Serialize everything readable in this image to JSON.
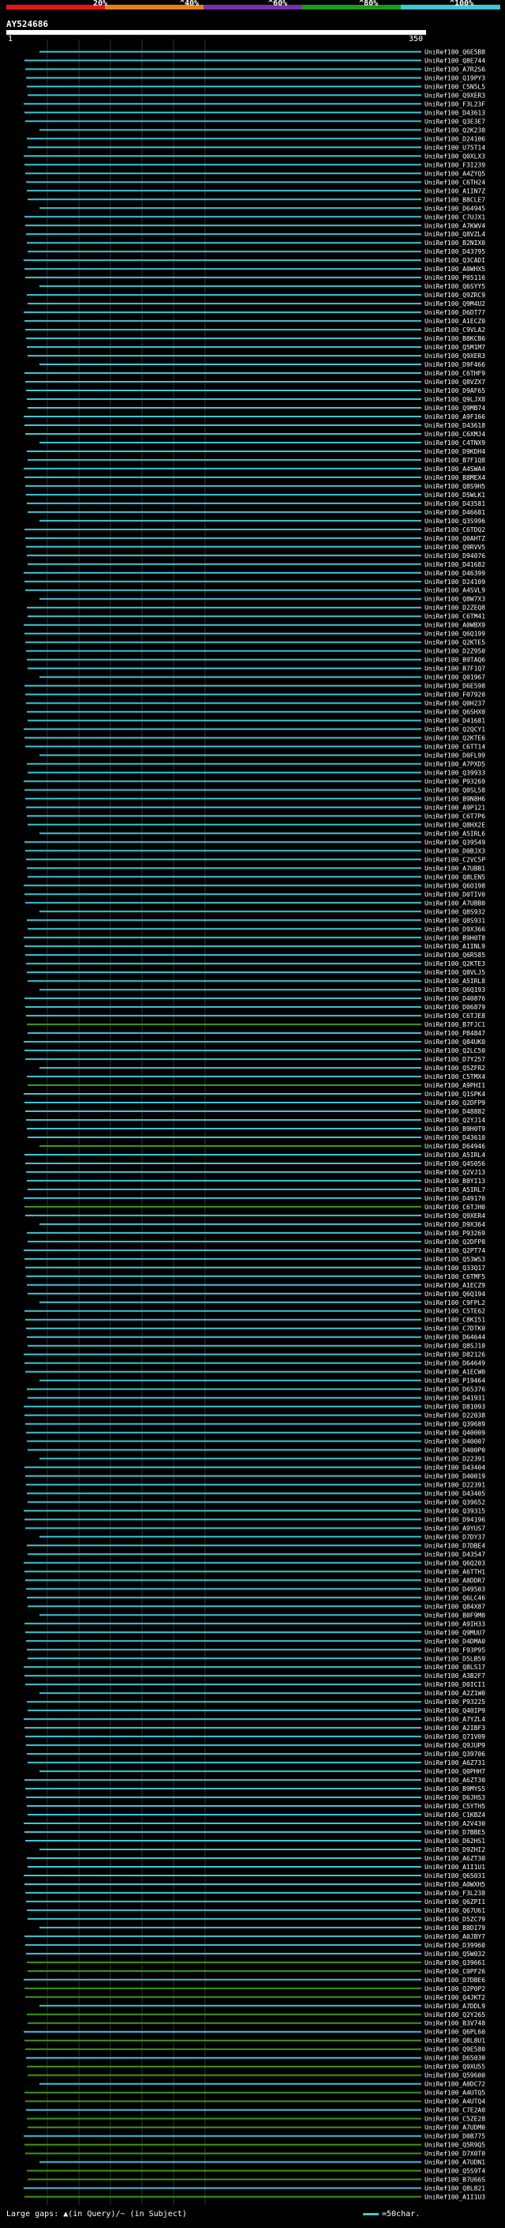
{
  "legend": {
    "labels": [
      "20%",
      "^40%",
      "^60%",
      "^80%",
      "^100%"
    ],
    "colors": [
      "#e8141c",
      "#e88014",
      "#7a2fb0",
      "#1a9a1a",
      "#3fc6d8"
    ]
  },
  "query_id": "AY524686",
  "ruler": {
    "start": "1",
    "end": "350"
  },
  "hit_color_high": "#3fc6d8",
  "hit_color_mid": "#3d9a12",
  "hits": [
    "UniRef100_Q6E5B8",
    "UniRef100_Q8E744",
    "UniRef100_A7R2S6",
    "UniRef100_Q19PY3",
    "UniRef100_C5N5L5",
    "UniRef100_Q9XER3",
    "UniRef100_F3L23F",
    "UniRef100_D43613",
    "UniRef100_Q3E3E7",
    "UniRef100_Q2K238",
    "UniRef100_D24106",
    "UniRef100_U75T14",
    "UniRef100_Q0XLX3",
    "UniRef100_F3I239",
    "UniRef100_A4ZYQ5",
    "UniRef100_C6TH24",
    "UniRef100_A1IN7Z",
    "UniRef100_B8CLE7",
    "UniRef100_D64945",
    "UniRef100_C7UJX1",
    "UniRef100_A7KWV4",
    "UniRef100_Q8VZL4",
    "UniRef100_B2NIX0",
    "UniRef100_D43795",
    "UniRef100_Q3CADI",
    "UniRef100_A0WHX5",
    "UniRef100_P05116",
    "UniRef100_Q6SYY5",
    "UniRef100_Q9ZRC9",
    "UniRef100_Q9M4U2",
    "UniRef100_D6DT77",
    "UniRef100_A1ECZ0",
    "UniRef100_C9VLA2",
    "UniRef100_B8KCB6",
    "UniRef100_Q5M1M7",
    "UniRef100_Q9XER3",
    "UniRef100_D9F466",
    "UniRef100_C6THF9",
    "UniRef100_Q8VZX7",
    "UniRef100_D9AF65",
    "UniRef100_Q9LJX8",
    "UniRef100_Q9MB74",
    "UniRef100_A9F166",
    "UniRef100_D43618",
    "UniRef100_C6XMJ4",
    "UniRef100_C4TNX9",
    "UniRef100_D9KDH4",
    "UniRef100_B7F1Q8",
    "UniRef100_A4SWA4",
    "UniRef100_B8MEX4",
    "UniRef100_Q8S9H5",
    "UniRef100_D5WLK1",
    "UniRef100_D43581",
    "UniRef100_D46681",
    "UniRef100_Q3S996",
    "UniRef100_C6TDQ2",
    "UniRef100_Q0AHTZ",
    "UniRef100_Q9RVV5",
    "UniRef100_D94076",
    "UniRef100_D41682",
    "UniRef100_D46399",
    "UniRef100_D24109",
    "UniRef100_A4SVL9",
    "UniRef100_Q8W7X3",
    "UniRef100_D2ZEQ8",
    "UniRef100_C6TM41",
    "UniRef100_A0WBX9",
    "UniRef100_Q6Q199",
    "UniRef100_Q2KTE5",
    "UniRef100_D2Z950",
    "UniRef100_B9TAQ6",
    "UniRef100_B7F1Q7",
    "UniRef100_Q01967",
    "UniRef100_D6E598",
    "UniRef100_F07920",
    "UniRef100_Q0H237",
    "UniRef100_Q6SHX0",
    "UniRef100_D41681",
    "UniRef100_Q2QCY1",
    "UniRef100_Q2KTE6",
    "UniRef100_C6TT14",
    "UniRef100_D0FL99",
    "UniRef100_A7PXD5",
    "UniRef100_Q39933",
    "UniRef100_P93269",
    "UniRef100_Q0SL58",
    "UniRef100_B9N8H6",
    "UniRef100_A9P121",
    "UniRef100_C6T7P6",
    "UniRef100_Q8HX2E",
    "UniRef100_A5IRL6",
    "UniRef100_Q39549",
    "UniRef100_D0BJX3",
    "UniRef100_C2VC5P",
    "UniRef100_A7UBB1",
    "UniRef100_Q8LEN5",
    "UniRef100_Q6O198",
    "UniRef100_D0TIV0",
    "UniRef100_A7UBB0",
    "UniRef100_Q8S932",
    "UniRef100_Q8S931",
    "UniRef100_D9X366",
    "UniRef100_B9H0T8",
    "UniRef100_A1INL9",
    "UniRef100_Q6R585",
    "UniRef100_Q2KTE3",
    "UniRef100_Q8VLJ5",
    "UniRef100_A5IRL8",
    "UniRef100_Q6Q193",
    "UniRef100_D40876",
    "UniRef100_D06879",
    "UniRef100_C6TJE8",
    "UniRef100_B7FJC1",
    "UniRef100_P84847",
    "UniRef100_Q84UK0",
    "UniRef100_Q2LC50",
    "UniRef100_D7Y257",
    "UniRef100_Q5ZFR2",
    "UniRef100_C5TMX4",
    "UniRef100_A9PHI1",
    "UniRef100_Q1SPK4",
    "UniRef100_Q2DFP9",
    "UniRef100_D48882",
    "UniRef100_Q2YJ14",
    "UniRef100_B9H0T9",
    "UniRef100_D43610",
    "UniRef100_D64946",
    "UniRef100_A5IRL4",
    "UniRef100_Q4S056",
    "UniRef100_Q2VJ13",
    "UniRef100_B8YI13",
    "UniRef100_A5IRL7",
    "UniRef100_D49170",
    "UniRef100_C6TJH0",
    "UniRef100_Q9XER4",
    "UniRef100_D9X364",
    "UniRef100_P93269",
    "UniRef100_Q2DFP8",
    "UniRef100_Q2PT74",
    "UniRef100_Q53WS3",
    "UniRef100_Q33Q17",
    "UniRef100_C6TMF5",
    "UniRef100_A1ECZ9",
    "UniRef100_Q6Q194",
    "UniRef100_C9FPL2",
    "UniRef100_C5TE62",
    "UniRef100_C8KI51",
    "UniRef100_C7DTK0",
    "UniRef100_D64644",
    "UniRef100_Q8SJ10",
    "UniRef100_D82126",
    "UniRef100_D64649",
    "UniRef100_A1ECW0",
    "UniRef100_P19464",
    "UniRef100_D65376",
    "UniRef100_D41931",
    "UniRef100_D81093",
    "UniRef100_D22038",
    "UniRef100_Q39689",
    "UniRef100_Q40009",
    "UniRef100_D40007",
    "UniRef100_D400P0",
    "UniRef100_D22391",
    "UniRef100_D43404",
    "UniRef100_D40019",
    "UniRef100_D22391",
    "UniRef100_D43405",
    "UniRef100_Q39652",
    "UniRef100_Q39315",
    "UniRef100_D94196",
    "UniRef100_A9YUS7",
    "UniRef100_D7DY37",
    "UniRef100_D7DBE4",
    "UniRef100_D43547",
    "UniRef100_Q6Q203",
    "UniRef100_A6TTH1",
    "UniRef100_A8DDR7",
    "UniRef100_D49503",
    "UniRef100_Q6LC46",
    "UniRef100_Q84X87",
    "UniRef100_B0F9M0",
    "UniRef100_A9IH33",
    "UniRef100_Q9MUU7",
    "UniRef100_D4DMA0",
    "UniRef100_F93P95",
    "UniRef100_D5LB59",
    "UniRef100_Q8LS17",
    "UniRef100_A3B2F7",
    "UniRef100_D0ICI1",
    "UniRef100_A2Z1W0",
    "UniRef100_P93225",
    "UniRef100_Q40IP9",
    "UniRef100_A7YZL4",
    "UniRef100_A2IBF3",
    "UniRef100_Q71V09",
    "UniRef100_Q9JUP9",
    "UniRef100_Q39706",
    "UniRef100_A6Z731",
    "UniRef100_Q0PHH7",
    "UniRef100_A6ZT30",
    "UniRef100_B9MYS5",
    "UniRef100_D6JHS3",
    "UniRef100_C5YTH5",
    "UniRef100_C1KBZ4",
    "UniRef100_A2V430",
    "UniRef100_D7BBE5",
    "UniRef100_D62HS1",
    "UniRef100_D9ZHI2",
    "UniRef100_A6ZT30",
    "UniRef100_A1I1U1",
    "UniRef100_Q65031",
    "UniRef100_A0WXH5",
    "UniRef100_F3L238",
    "UniRef100_Q6ZPI1",
    "UniRef100_Q67U61",
    "UniRef100_D5ZC79",
    "UniRef100_B8DI79",
    "UniRef100_A0JBY7",
    "UniRef100_D39960",
    "UniRef100_Q5W032",
    "UniRef100_Q39661",
    "UniRef100_C0PF26",
    "UniRef100_D7DBE6",
    "UniRef100_Q2P0P2",
    "UniRef100_Q4JKT2",
    "UniRef100_A7DDL9",
    "UniRef100_Q2Y265",
    "UniRef100_B3V748",
    "UniRef100_Q6PL60",
    "UniRef100_Q8L8U1",
    "UniRef100_Q9E580",
    "UniRef100_D65030",
    "UniRef100_Q9XU55",
    "UniRef100_Q59600",
    "UniRef100_A0DC72",
    "UniRef100_A4UTQ5",
    "UniRef100_A4UTQ4",
    "UniRef100_C7E2A0",
    "UniRef100_C5ZE28",
    "UniRef100_A7UDM0",
    "UniRef100_D0B775",
    "UniRef100_Q5R9Q5",
    "UniRef100_D7X0T0",
    "UniRef100_A7UDN1",
    "UniRef100_Q5S9T4",
    "UniRef100_B7U66S",
    "UniRef100_Q8L821",
    "UniRef100_A1I1U3"
  ],
  "footer": "Large gaps: ▲(in Query)/~ (in Subject)",
  "scale_label": "=50char."
}
